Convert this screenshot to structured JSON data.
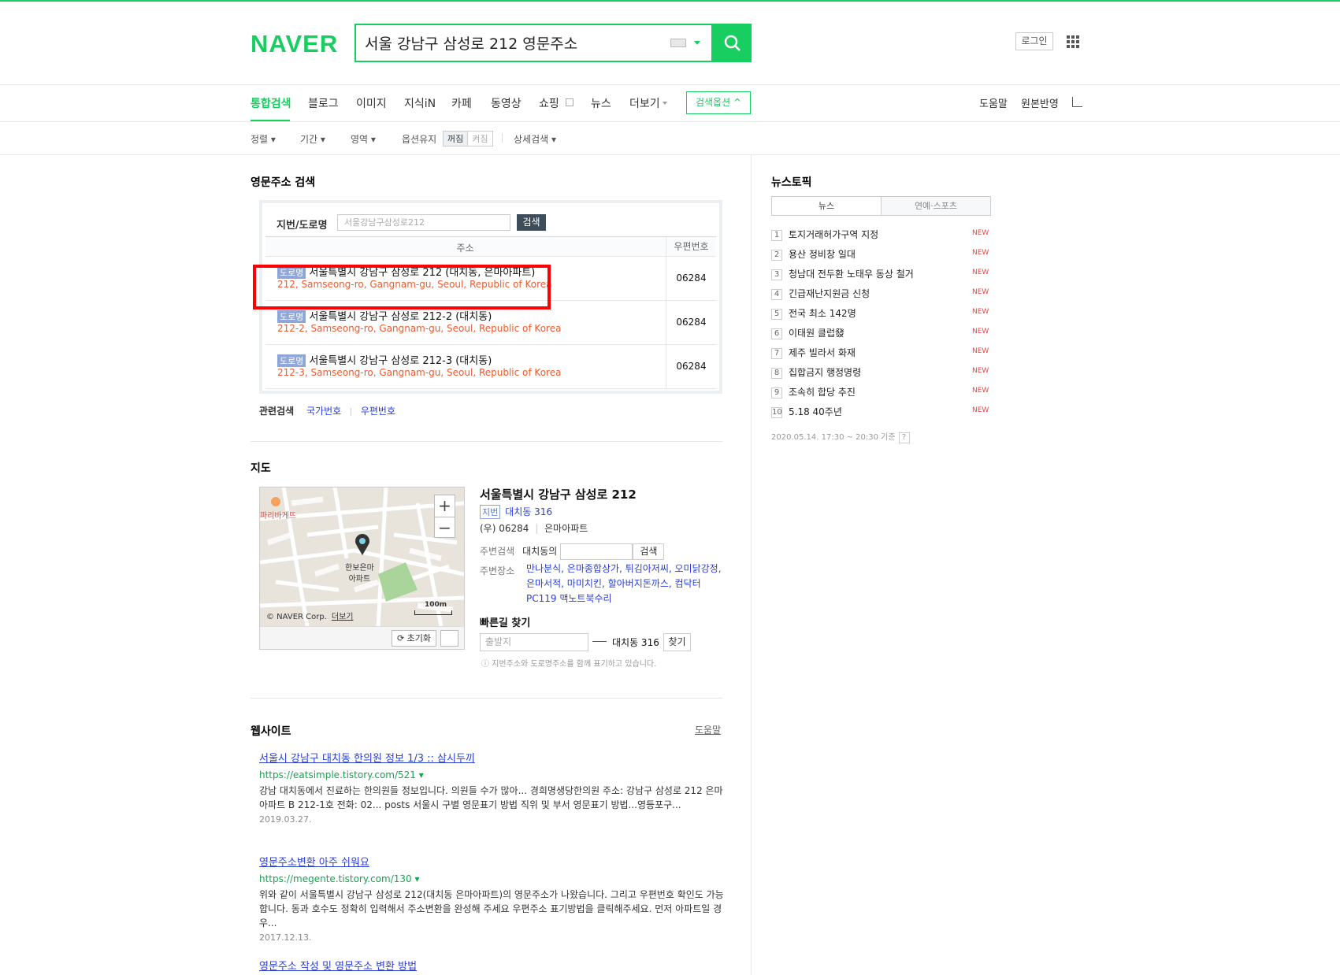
{
  "header": {
    "logo": "NAVER",
    "query": "서울 강남구 삼성로 212 영문주소",
    "login": "로그인"
  },
  "tabs": [
    "통합검색",
    "블로그",
    "이미지",
    "지식iN",
    "카페",
    "동영상",
    "쇼핑",
    "뉴스",
    "더보기"
  ],
  "search_options_button": "검색옵션",
  "right_links": [
    "도움말",
    "원본반영"
  ],
  "options_bar": {
    "sort": "정렬",
    "period": "기간",
    "area": "영역",
    "keep": "옵션유지",
    "keep_off": "꺼짐",
    "keep_on": "켜짐",
    "detail": "상세검색"
  },
  "english_address": {
    "title": "영문주소 검색",
    "input_label": "지번/도로명",
    "input_placeholder": "서울강남구삼성로212",
    "search_button": "검색",
    "col_address": "주소",
    "col_zip": "우편번호",
    "badge": "도로명",
    "rows": [
      {
        "kr": "서울특별시 강남구 삼성로 212 (대치동, 은마아파트)",
        "en": "212, Samseong-ro, Gangnam-gu, Seoul, Republic of Korea",
        "zip": "06284"
      },
      {
        "kr": "서울특별시 강남구 삼성로 212-2 (대치동)",
        "en": "212-2, Samseong-ro, Gangnam-gu, Seoul, Republic of Korea",
        "zip": "06284"
      },
      {
        "kr": "서울특별시 강남구 삼성로 212-3 (대치동)",
        "en": "212-3, Samseong-ro, Gangnam-gu, Seoul, Republic of Korea",
        "zip": "06284"
      }
    ],
    "related_label": "관련검색",
    "related": [
      "국가번호",
      "우편번호"
    ]
  },
  "map_section": {
    "title": "지도",
    "map_label_store": "파리바게뜨",
    "map_label_apt": "한보은마\n아파트",
    "copyright": "© NAVER Corp.",
    "more": "더보기",
    "scale": "100m",
    "reset": "초기화",
    "address_title": "서울특별시 강남구 삼성로 212",
    "jibeon_badge": "지번",
    "jibeon": "대치동 316",
    "zip_line": "(우) 06284",
    "building": "은마아파트",
    "nearby_search_label": "주변검색",
    "nearby_search_prefix": "대치동의",
    "nearby_search_btn": "검색",
    "nearby_places_label": "주변장소",
    "nearby_places": "만나분식, 은마종합상가, 튀김아저씨, 오미닭강정, 은마서적, 마미치킨, 할아버지돈까스, 컴닥터PC119 맥노트북수리",
    "fast_route_title": "빠른길 찾기",
    "from_placeholder": "출발지",
    "destination": "대치동 316",
    "find_btn": "찾기",
    "note": "지번주소와 도로명주소를 함께 표기하고 있습니다."
  },
  "websites": {
    "title": "웹사이트",
    "help": "도움말",
    "results": [
      {
        "title": "서울시 강남구 대치동 한의원 정보 1/3 :: 삼시두끼",
        "url": "https://eatsimple.tistory.com/521",
        "desc": "강남 대치동에서 진료하는 한의원들 정보입니다. 의원들 수가 많아... 경희명생당한의원 주소: 강남구 삼성로 212 은마아파트 B 212-1호 전화: 02... posts 서울시 구별 영문표기 방법 직위 및 부서 영문표기 방법...영등포구...",
        "date": "2019.03.27."
      },
      {
        "title": "영문주소변환 아주 쉬워요",
        "url": "https://megente.tistory.com/130",
        "desc": "위와 같이 서울특별시 강남구 삼성로 212(대치동 은마아파트)의 영문주소가 나왔습니다. 그리고 우편번호 확인도 가능합니다. 동과 호수도 정확히 입력해서 주소변환을 완성해 주세요 우편주소 표기방법을 클릭해주세요. 먼저 아파트일 경우...",
        "date": "2017.12.13."
      },
      {
        "title": "영문주소 작성 및 영문주소 변환 방법",
        "url": "",
        "desc": "",
        "date": ""
      }
    ]
  },
  "news_topic": {
    "title": "뉴스토픽",
    "tab_news": "뉴스",
    "tab_ent": "연예·스포츠",
    "new_label": "NEW",
    "items": [
      "토지거래허가구역 지정",
      "용산 정비창 일대",
      "청남대 전두환 노태우 동상 철거",
      "긴급재난지원금 신청",
      "전국 최소 142명",
      "이태원 클럽發",
      "제주 빌라서 화재",
      "집합금지 행정명령",
      "조속히 합당 추진",
      "5.18 40주년"
    ],
    "time": "2020.05.14. 17:30 ~ 20:30 기준"
  },
  "colors": {
    "brand": "#19ce60",
    "link": "#2a3fd6",
    "english": "#ee5a2e",
    "highlight_box": "#ff0000"
  }
}
